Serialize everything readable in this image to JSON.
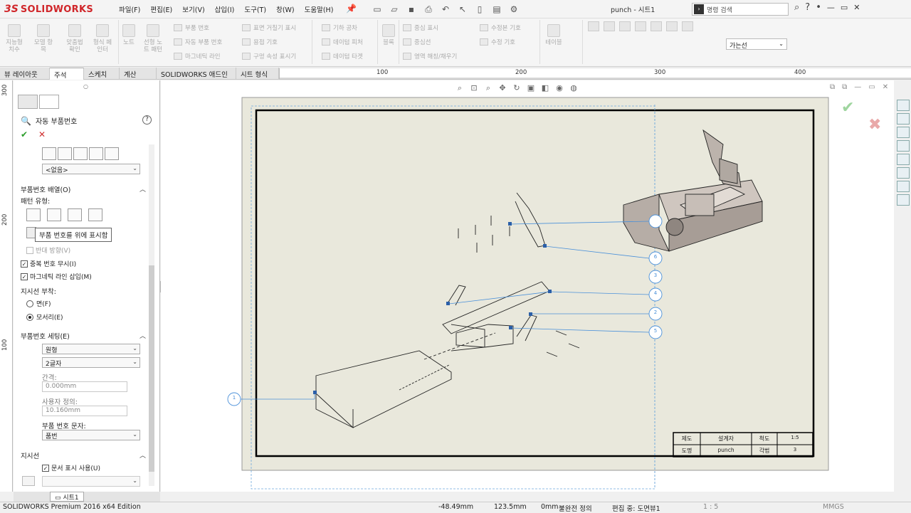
{
  "titlebar": {
    "logo_ds": "3S",
    "logo_text": "SOLIDWORKS",
    "menu": [
      "파일(F)",
      "편집(E)",
      "보기(V)",
      "삽입(I)",
      "도구(T)",
      "창(W)",
      "도움말(H)"
    ],
    "document_title": "punch - 시트1",
    "command_search_placeholder": "명령 검색",
    "help_glyph": "?",
    "icons": [
      "new-icon",
      "open-icon",
      "save-icon",
      "print-icon",
      "undo-icon",
      "select-icon",
      "rebuild-icon",
      "file-props-icon",
      "options-icon"
    ]
  },
  "ribbon": {
    "large_buttons": [
      {
        "label": "지능형\n치수",
        "icon": "smart-dimension-icon"
      },
      {
        "label": "모델 항\n목",
        "icon": "model-items-icon"
      },
      {
        "label": "맞춤법\n확인",
        "icon": "spell-check-icon"
      },
      {
        "label": "형식 페\n인터",
        "icon": "format-painter-icon"
      },
      {
        "label": "노트",
        "icon": "note-icon"
      },
      {
        "label": "선형 노\n트 패턴",
        "icon": "linear-note-pattern-icon"
      }
    ],
    "group1": [
      "부품 번호",
      "자동 부품 번호",
      "마그네틱 라인"
    ],
    "group2": [
      "표면 거칠기 표시",
      "용접 기호",
      "구멍 속성 표시기"
    ],
    "group3": [
      "기하 공차",
      "데이텀 피처",
      "데이텀 타겟"
    ],
    "group4_big": {
      "label": "블록",
      "icon": "block-icon"
    },
    "group5": [
      "중심 표시",
      "중심선",
      "영역 해칭/채우기"
    ],
    "group6": [
      "수정본 기호",
      "수정 기호"
    ],
    "group7_big": {
      "label": "테이블",
      "icon": "table-icon"
    },
    "line_style": "가는선"
  },
  "tabs": [
    "뷰 레이아웃",
    "주석",
    "스케치",
    "계산",
    "SOLIDWORKS 애드인",
    "시트 형식"
  ],
  "active_tab": "주석",
  "ruler": {
    "h": [
      "100",
      "200",
      "300",
      "400"
    ],
    "v": [
      "300",
      "200",
      "100"
    ]
  },
  "pm": {
    "title": "자동 부품번호",
    "help": "?",
    "ok": "✔",
    "cancel": "✕",
    "style_select": "<없음>",
    "layout_section": "부품번호 배열(O)",
    "pattern_label": "패턴 유형:",
    "tooltip": "부품 번호를 위에 표시함",
    "reverse_dir": "반대 방향(V)",
    "ignore_dup": "중복 번호 무시(I)",
    "insert_magnetic": "마그네틱 라인 삽입(M)",
    "leader_attach_label": "지시선 부착:",
    "attach_face": "면(F)",
    "attach_edge": "모서리(E)",
    "settings_section": "부품번호 세팅(E)",
    "shape_select": "원형",
    "size_select": "2글자",
    "gap_label": "간격:",
    "gap_value": "0.000mm",
    "user_def_label": "사용자 정의:",
    "user_def_value": "10.160mm",
    "text_label": "부품 번호 문자:",
    "text_select": "품번",
    "leader_section": "지시선",
    "use_doc_display": "문서 표시 사용(U)"
  },
  "sheet_tab": "시트1",
  "drawing": {
    "title_block": {
      "r1": [
        "제도",
        "설계자",
        "척도",
        "1:5"
      ],
      "r2": [
        "도명",
        "punch",
        "각법",
        "3"
      ]
    },
    "balloons": [
      "1",
      "6",
      "3",
      "4",
      "2",
      "5"
    ]
  },
  "status": {
    "edition": "SOLIDWORKS Premium 2016 x64 Edition",
    "x": "-48.49mm",
    "y": "123.5mm",
    "z": "0mm",
    "define": "불완전 정의",
    "editing": "편집 중: 도면뷰1",
    "scale": "1 : 5",
    "units": "MMGS"
  }
}
